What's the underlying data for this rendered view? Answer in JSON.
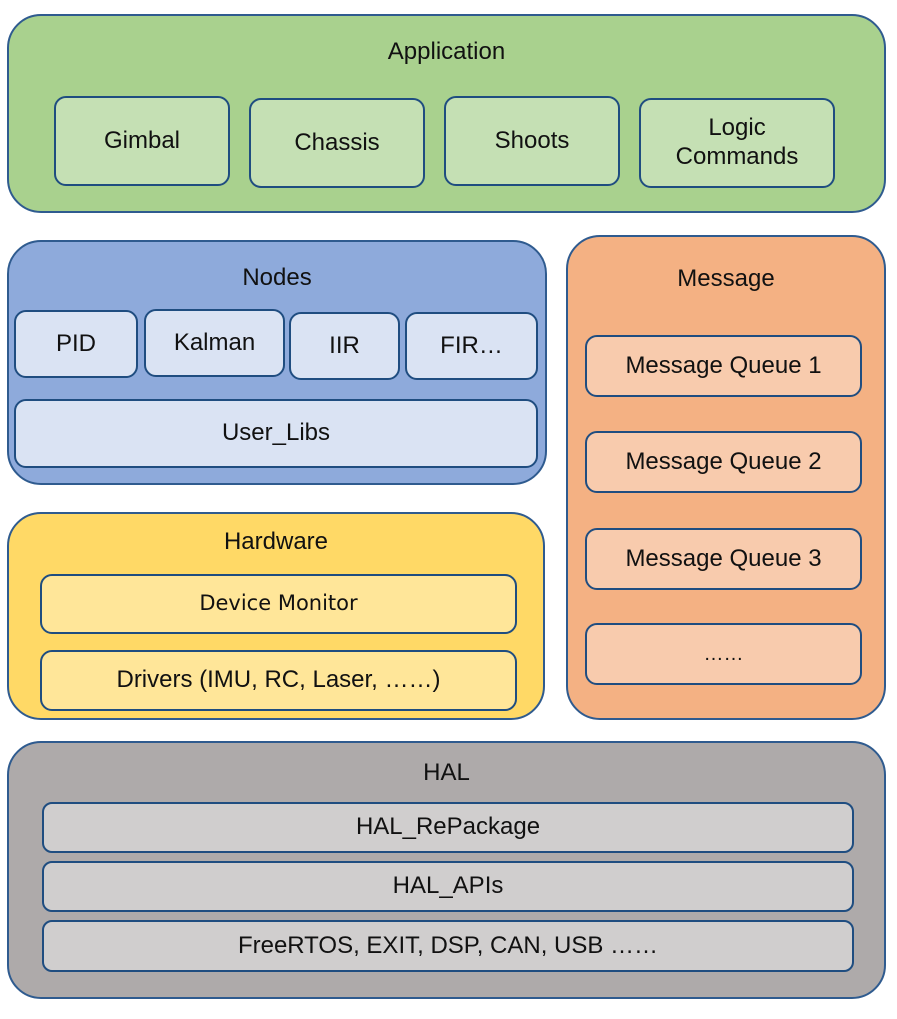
{
  "diagram": {
    "application": {
      "title": "Application",
      "color": "#a9d18e",
      "modules": [
        "Gimbal",
        "Chassis",
        "Shoots",
        "Logic Commands"
      ]
    },
    "nodes": {
      "title": "Nodes",
      "color": "#8eaadb",
      "filters": [
        "PID",
        "Kalman",
        "IIR",
        "FIR…"
      ],
      "libs": "User_Libs"
    },
    "message": {
      "title": "Message",
      "color": "#f4b183",
      "queues": [
        "Message Queue 1",
        "Message Queue 2",
        "Message Queue 3",
        "……"
      ]
    },
    "hardware": {
      "title": "Hardware",
      "color": "#ffd966",
      "items": [
        "Device Monitor",
        "Drivers (IMU, RC, Laser, ……)"
      ]
    },
    "hal": {
      "title": "HAL",
      "color": "#aeaaaa",
      "items": [
        "HAL_RePackage",
        "HAL_APIs",
        "FreeRTOS, EXIT, DSP, CAN, USB ……"
      ]
    },
    "border_color": "#2f5b8f"
  }
}
